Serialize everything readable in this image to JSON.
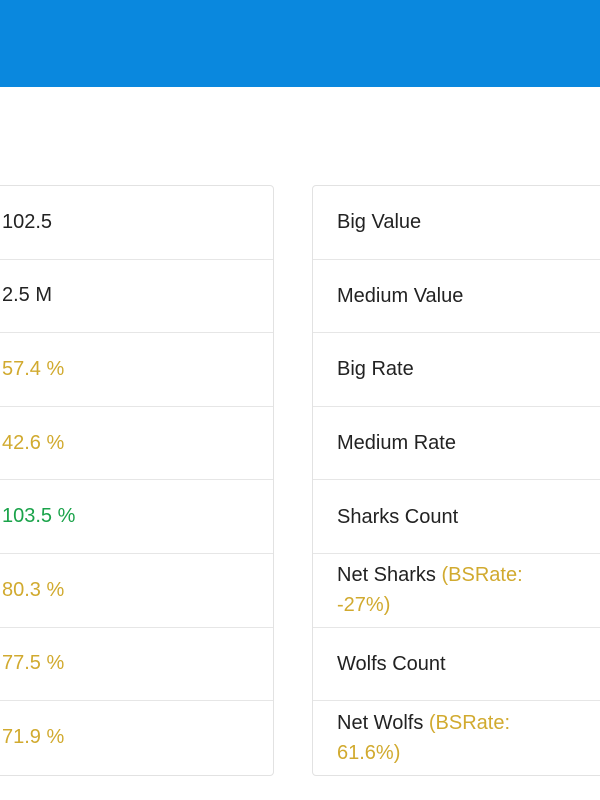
{
  "colors": {
    "header": "#0a88de",
    "yellow": "#d1aa2f",
    "green": "#1aa34a",
    "text": "#222222"
  },
  "values": [
    {
      "text": "102.5",
      "color": "dark"
    },
    {
      "text": "2.5 M",
      "color": "dark"
    },
    {
      "text": "57.4 %",
      "color": "yellow"
    },
    {
      "text": "42.6 %",
      "color": "yellow"
    },
    {
      "text": "103.5 %",
      "color": "green"
    },
    {
      "text": "80.3 %",
      "color": "yellow"
    },
    {
      "text": "77.5 %",
      "color": "yellow"
    },
    {
      "text": "71.9 %",
      "color": "yellow"
    }
  ],
  "labels": [
    {
      "text": "Big Value"
    },
    {
      "text": "Medium Value"
    },
    {
      "text": "Big Rate"
    },
    {
      "text": "Medium Rate"
    },
    {
      "text": "Sharks Count"
    },
    {
      "text": "Net Sharks",
      "extra": "(BSRate: -27%)"
    },
    {
      "text": "Wolfs Count"
    },
    {
      "text": "Net Wolfs",
      "extra": "(BSRate: 61.6%)"
    }
  ]
}
